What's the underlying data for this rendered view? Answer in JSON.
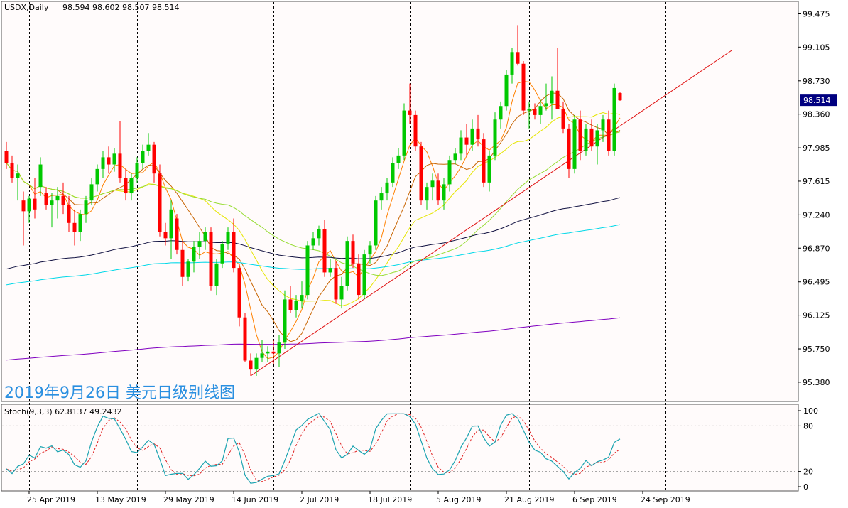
{
  "header": {
    "symbol": "USDX,Daily",
    "ohlc": "98.594 98.602 98.507 98.514"
  },
  "watermark": "2019年9月26日 美元日级别线图",
  "colors": {
    "bull": "#00c800",
    "bear": "#ff0000",
    "background": "#fffbfb",
    "grid": "#000000",
    "trendline": "#e01010",
    "stoch_main": "#1aa3b0",
    "stoch_signal": "#e02020",
    "price_label_bg": "#000080"
  },
  "chart_data": [
    {
      "type": "candlestick",
      "title": "USDX,Daily",
      "ylim": [
        95.3,
        99.55
      ],
      "y_ticks": [
        "99.475",
        "99.105",
        "98.730",
        "98.360",
        "97.985",
        "97.615",
        "97.240",
        "96.870",
        "96.495",
        "96.125",
        "95.750",
        "95.380"
      ],
      "current_price": "98.514",
      "x_tick_labels": [
        {
          "label": "25 Apr 2019",
          "index": 4
        },
        {
          "label": "13 May 2019",
          "index": 16
        },
        {
          "label": "29 May 2019",
          "index": 28
        },
        {
          "label": "14 Jun 2019",
          "index": 40
        },
        {
          "label": "2 Jul 2019",
          "index": 52
        },
        {
          "label": "18 Jul 2019",
          "index": 64
        },
        {
          "label": "5 Aug 2019",
          "index": 76
        },
        {
          "label": "21 Aug 2019",
          "index": 88
        },
        {
          "label": "6 Sep 2019",
          "index": 100
        },
        {
          "label": "24 Sep 2019",
          "index": 112
        }
      ],
      "vertical_grid_indices": [
        4,
        23,
        47,
        71,
        92,
        116
      ],
      "candles": [
        [
          97.95,
          98.05,
          97.75,
          97.82
        ],
        [
          97.82,
          97.9,
          97.6,
          97.65
        ],
        [
          97.65,
          97.8,
          97.4,
          97.7
        ],
        [
          97.4,
          97.5,
          96.9,
          97.28
        ],
        [
          97.28,
          97.45,
          97.15,
          97.42
        ],
        [
          97.42,
          97.65,
          97.2,
          97.3
        ],
        [
          97.55,
          97.88,
          97.45,
          97.8
        ],
        [
          97.48,
          97.55,
          97.3,
          97.35
        ],
        [
          97.35,
          97.48,
          97.1,
          97.4
        ],
        [
          97.4,
          97.55,
          97.2,
          97.45
        ],
        [
          97.45,
          97.6,
          97.25,
          97.35
        ],
        [
          97.35,
          97.45,
          97.05,
          97.15
        ],
        [
          97.15,
          97.3,
          96.9,
          97.05
        ],
        [
          97.05,
          97.3,
          96.95,
          97.25
        ],
        [
          97.25,
          97.45,
          97.15,
          97.4
        ],
        [
          97.4,
          97.65,
          97.35,
          97.58
        ],
        [
          97.58,
          97.8,
          97.5,
          97.75
        ],
        [
          97.75,
          97.95,
          97.65,
          97.88
        ],
        [
          97.88,
          98.0,
          97.7,
          97.8
        ],
        [
          97.8,
          97.98,
          97.72,
          97.92
        ],
        [
          97.92,
          98.28,
          97.6,
          97.65
        ],
        [
          97.65,
          97.75,
          97.4,
          97.48
        ],
        [
          97.48,
          97.7,
          97.4,
          97.65
        ],
        [
          97.65,
          97.88,
          97.6,
          97.82
        ],
        [
          97.82,
          98.02,
          97.75,
          97.95
        ],
        [
          97.95,
          98.15,
          97.9,
          98.02
        ],
        [
          98.02,
          98.05,
          97.6,
          97.7
        ],
        [
          97.7,
          97.8,
          97.0,
          97.05
        ],
        [
          97.05,
          97.15,
          96.9,
          96.98
        ],
        [
          96.98,
          97.4,
          96.75,
          97.3
        ],
        [
          97.2,
          97.25,
          96.8,
          96.85
        ],
        [
          96.85,
          96.95,
          96.45,
          96.55
        ],
        [
          96.55,
          96.75,
          96.5,
          96.72
        ],
        [
          96.72,
          96.95,
          96.6,
          96.88
        ],
        [
          96.88,
          97.05,
          96.75,
          96.95
        ],
        [
          96.95,
          97.1,
          96.85,
          97.05
        ],
        [
          97.05,
          97.1,
          96.4,
          96.45
        ],
        [
          96.45,
          96.75,
          96.35,
          96.7
        ],
        [
          96.7,
          96.95,
          96.65,
          96.92
        ],
        [
          96.92,
          97.1,
          96.85,
          97.05
        ],
        [
          97.05,
          97.2,
          96.6,
          96.65
        ],
        [
          96.65,
          96.7,
          96.0,
          96.1
        ],
        [
          96.1,
          96.15,
          95.6,
          95.62
        ],
        [
          95.62,
          95.7,
          95.45,
          95.52
        ],
        [
          95.52,
          95.7,
          95.45,
          95.65
        ],
        [
          95.65,
          95.85,
          95.6,
          95.7
        ],
        [
          95.7,
          95.78,
          95.6,
          95.72
        ],
        [
          95.72,
          95.85,
          95.58,
          95.7
        ],
        [
          95.7,
          95.9,
          95.55,
          95.82
        ],
        [
          95.82,
          96.4,
          95.75,
          96.3
        ],
        [
          96.3,
          96.45,
          96.15,
          96.18
        ],
        [
          96.18,
          96.35,
          96.1,
          96.28
        ],
        [
          96.28,
          96.5,
          96.2,
          96.35
        ],
        [
          96.35,
          96.95,
          96.3,
          96.9
        ],
        [
          96.9,
          97.05,
          96.85,
          96.98
        ],
        [
          96.98,
          97.12,
          96.9,
          97.08
        ],
        [
          97.08,
          97.18,
          96.55,
          96.6
        ],
        [
          96.6,
          96.75,
          96.55,
          96.65
        ],
        [
          96.65,
          96.72,
          96.25,
          96.3
        ],
        [
          96.3,
          96.55,
          96.2,
          96.45
        ],
        [
          96.45,
          97.0,
          96.4,
          96.95
        ],
        [
          96.95,
          97.02,
          96.65,
          96.7
        ],
        [
          96.7,
          96.8,
          96.3,
          96.35
        ],
        [
          96.35,
          96.85,
          96.3,
          96.8
        ],
        [
          96.8,
          96.95,
          96.7,
          96.9
        ],
        [
          96.9,
          97.45,
          96.85,
          97.4
        ],
        [
          97.4,
          97.55,
          97.3,
          97.48
        ],
        [
          97.48,
          97.65,
          97.4,
          97.6
        ],
        [
          97.6,
          97.88,
          97.55,
          97.82
        ],
        [
          97.82,
          97.98,
          97.75,
          97.9
        ],
        [
          97.9,
          98.48,
          97.85,
          98.4
        ],
        [
          98.4,
          98.7,
          98.25,
          98.35
        ],
        [
          98.35,
          98.4,
          97.95,
          98.0
        ],
        [
          98.0,
          98.05,
          97.35,
          97.4
        ],
        [
          97.4,
          97.6,
          97.3,
          97.55
        ],
        [
          97.55,
          97.7,
          97.4,
          97.62
        ],
        [
          97.62,
          97.7,
          97.35,
          97.4
        ],
        [
          97.4,
          97.65,
          97.3,
          97.58
        ],
        [
          97.58,
          97.9,
          97.5,
          97.85
        ],
        [
          97.85,
          97.98,
          97.8,
          97.92
        ],
        [
          97.92,
          98.18,
          97.85,
          98.1
        ],
        [
          98.1,
          98.25,
          97.9,
          98.02
        ],
        [
          98.02,
          98.3,
          97.95,
          98.2
        ],
        [
          98.2,
          98.35,
          98.0,
          98.08
        ],
        [
          98.08,
          98.15,
          97.55,
          97.6
        ],
        [
          97.6,
          97.95,
          97.5,
          97.9
        ],
        [
          97.9,
          98.38,
          97.85,
          98.3
        ],
        [
          98.3,
          98.5,
          98.2,
          98.45
        ],
        [
          98.45,
          98.85,
          98.4,
          98.8
        ],
        [
          98.8,
          99.1,
          98.7,
          99.05
        ],
        [
          99.05,
          99.35,
          98.9,
          98.92
        ],
        [
          98.92,
          98.95,
          98.35,
          98.4
        ],
        [
          98.4,
          98.5,
          98.2,
          98.42
        ],
        [
          98.42,
          98.48,
          98.3,
          98.35
        ],
        [
          98.35,
          98.52,
          98.25,
          98.45
        ],
        [
          98.45,
          98.7,
          98.4,
          98.48
        ],
        [
          98.48,
          98.78,
          98.3,
          98.62
        ],
        [
          98.62,
          99.1,
          98.55,
          98.42
        ],
        [
          98.42,
          98.5,
          98.15,
          98.2
        ],
        [
          98.2,
          98.25,
          97.65,
          97.75
        ],
        [
          97.75,
          98.35,
          97.7,
          98.3
        ],
        [
          98.3,
          98.4,
          97.85,
          97.95
        ],
        [
          97.95,
          98.25,
          97.9,
          98.2
        ],
        [
          98.2,
          98.3,
          97.95,
          98.0
        ],
        [
          98.0,
          98.25,
          97.8,
          98.18
        ],
        [
          98.18,
          98.35,
          98.05,
          98.3
        ],
        [
          98.3,
          98.4,
          97.9,
          97.95
        ],
        [
          97.95,
          98.7,
          97.9,
          98.65
        ],
        [
          98.594,
          98.602,
          98.507,
          98.514
        ]
      ],
      "moving_averages": [
        {
          "color": "#ff8000",
          "period": 5
        },
        {
          "color": "#c86400",
          "period": 10
        },
        {
          "color": "#e6e600",
          "period": 20
        },
        {
          "color": "#96dc32",
          "period": 40
        },
        {
          "color": "#101040",
          "period": 60
        },
        {
          "color": "#00d8e8",
          "period": 100
        },
        {
          "color": "#8000c0",
          "period": 200
        }
      ],
      "ma_seed": {
        "period_60": 96.62,
        "period_100": 96.45,
        "period_200": 95.62
      }
    },
    {
      "type": "line",
      "title": "Stoch(9,3,3) 62.8137 49.2432",
      "ylim": [
        0,
        100
      ],
      "y_ticks": [
        "100",
        "80",
        "20",
        "0"
      ],
      "levels": [
        80,
        20
      ],
      "main_last": "62.8137",
      "signal_last": "49.2432"
    }
  ]
}
